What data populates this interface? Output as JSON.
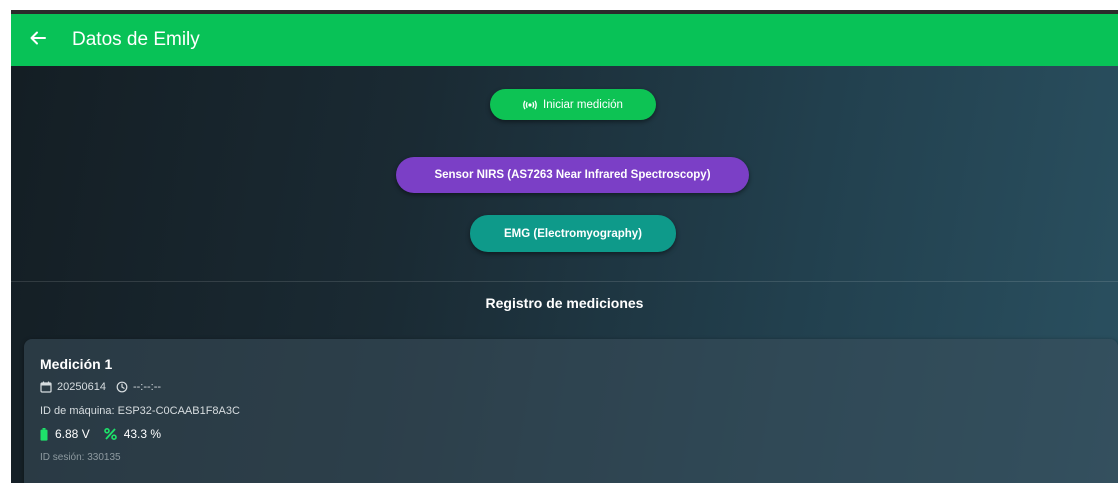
{
  "appbar": {
    "title": "Datos de Emily",
    "back_icon": "arrow-left-icon",
    "color": "#08c257"
  },
  "actions": {
    "start_label": "Iniciar medición",
    "start_icon": "sensor-signal-icon",
    "nirs_label": "Sensor NIRS (AS7263 Near Infrared Spectroscopy)",
    "emg_label": "EMG (Electromyography)",
    "colors": {
      "start": "#0dc354",
      "nirs": "#7b3fc6",
      "emg": "#0e9a8a"
    }
  },
  "log": {
    "title": "Registro de mediciones",
    "items": [
      {
        "title": "Medición 1",
        "date": "20250614",
        "time": "--:--:--",
        "machine": "ID de máquina: ESP32-C0CAAB1F8A3C",
        "voltage": "6.88 V",
        "percent": "43.3 %",
        "session": "ID sesión: 330135"
      }
    ]
  }
}
